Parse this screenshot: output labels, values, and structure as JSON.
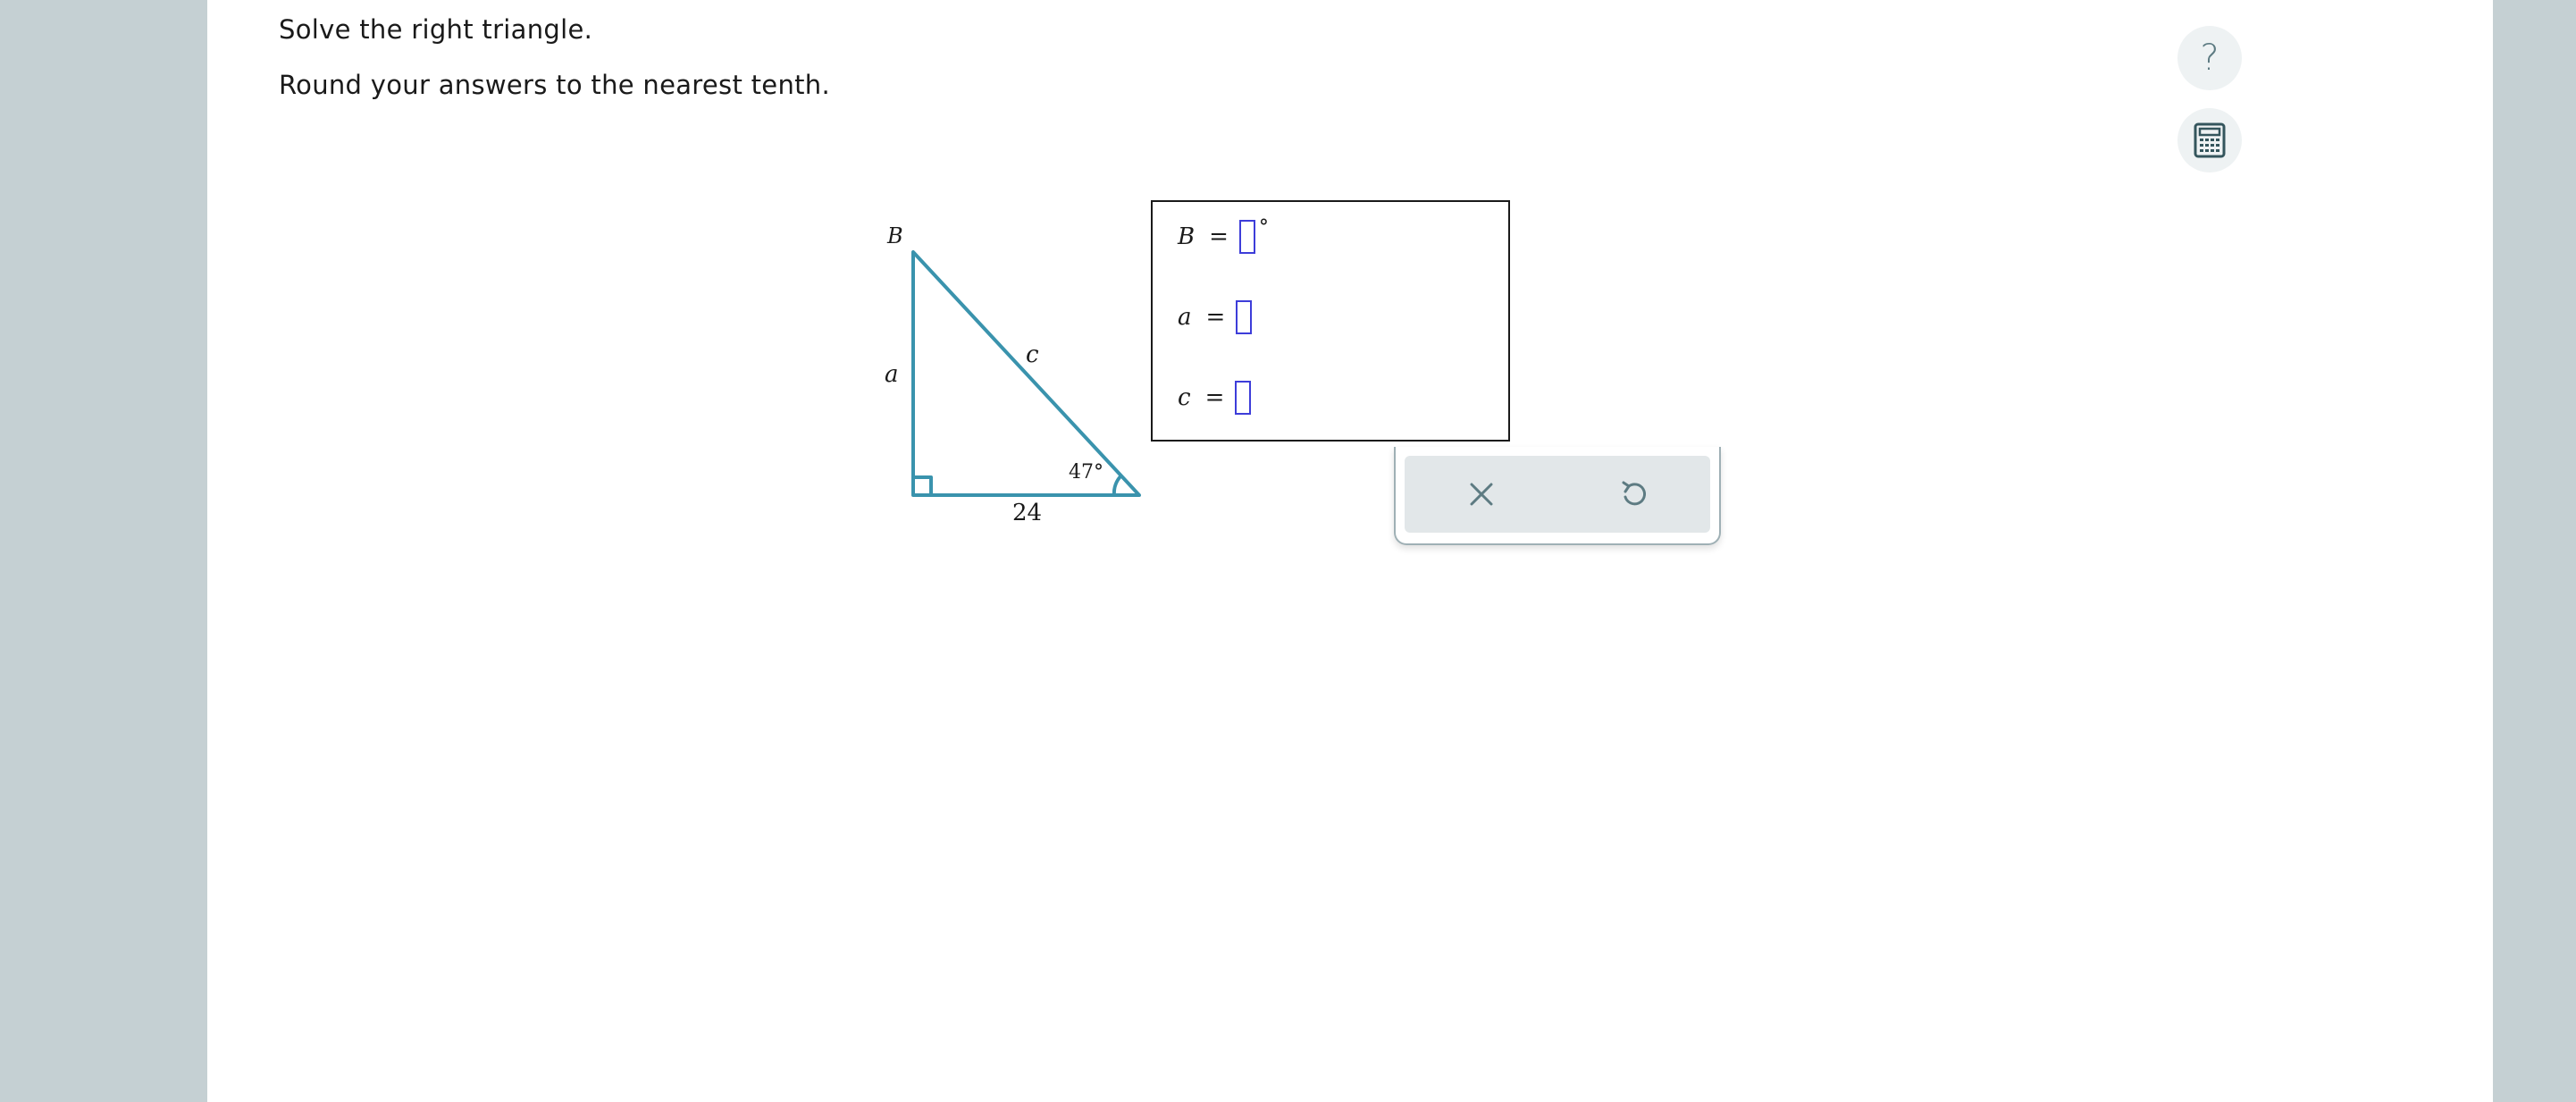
{
  "instructions": {
    "line1": "Solve the right triangle.",
    "line2": "Round your answers to the nearest tenth."
  },
  "sidebar": {
    "help_icon": "question-mark-icon",
    "help_glyph": "?",
    "calculator_icon": "calculator-icon"
  },
  "figure": {
    "vertex_label": "B",
    "side_a_label": "a",
    "side_c_label": "c",
    "angle_label": "47°",
    "base_label": "24",
    "stroke_color": "#3a93ad"
  },
  "answers": {
    "b": {
      "variable": "B",
      "equals": "=",
      "value": "",
      "unit": "°"
    },
    "a": {
      "variable": "a",
      "equals": "=",
      "value": ""
    },
    "c": {
      "variable": "c",
      "equals": "=",
      "value": ""
    }
  },
  "tools": {
    "clear_icon": "close-icon",
    "undo_icon": "undo-icon"
  },
  "colors": {
    "background": "#c5d0d3",
    "input_border": "#3d3dd9",
    "icon_color": "#5d7b82"
  }
}
